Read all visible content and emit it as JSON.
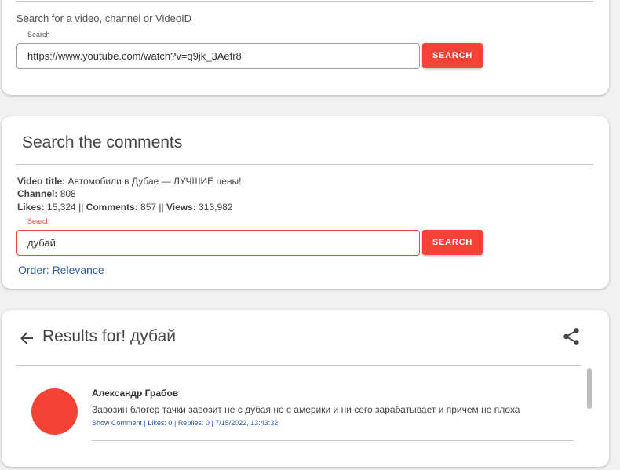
{
  "video_search": {
    "prompt": "Search for a video, channel or VideoID",
    "field_label": "Search",
    "value": "https://www.youtube.com/watch?v=q9jk_3Aefr8",
    "button_label": "SEARCH"
  },
  "comment_search": {
    "title": "Search the comments",
    "video_title_label": "Video title:",
    "video_title": "Автомобили в Дубае — ЛУЧШИЕ цены!",
    "channel_label": "Channel:",
    "channel": "808",
    "likes_label": "Likes:",
    "likes": "15,324",
    "comments_label": "Comments:",
    "comments": "857",
    "views_label": "Views:",
    "views": "313,982",
    "separator": "||",
    "field_label": "Search",
    "value": "дубай",
    "button_label": "SEARCH",
    "order_link": "Order: Relevance"
  },
  "results": {
    "title": "Results for! дубай",
    "icons": {
      "back": "arrow-left-icon",
      "share": "share-icon"
    },
    "comments": [
      {
        "author": "Александр Грабов",
        "text": "Завозин блогер тачки завозит не с дубая но с америки и ни сего зарабатывает и причем не плоха",
        "show_comment": "Show Comment",
        "likes": "Likes: 0",
        "replies": "Replies: 0",
        "date": "7/15/2022, 13:43:32",
        "sep": "|",
        "avatar_color": "#f44336"
      }
    ]
  },
  "colors": {
    "accent": "#f44336",
    "link": "#2a5ea8",
    "background": "#f1f1f1"
  }
}
